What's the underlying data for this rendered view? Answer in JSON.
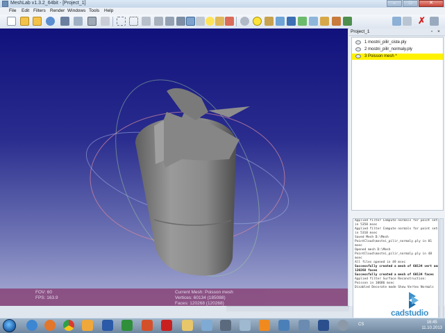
{
  "window": {
    "title": "MeshLab v1.3.2_64bit - [Project_1]"
  },
  "menu": [
    "File",
    "Edit",
    "Filters",
    "Render",
    "Windows",
    "Tools",
    "Help"
  ],
  "toolbar": {
    "icons": [
      "new-project-icon",
      "open-project-icon",
      "open-mesh-icon",
      "reload-icon",
      "save-icon",
      "snapshot-icon",
      "import-raster-icon",
      "print-icon",
      "bbox-icon",
      "points-icon",
      "wireframe-icon",
      "hidden-lines-icon",
      "flat-lines-icon",
      "flat-icon",
      "smooth-icon",
      "texture-icon",
      "light-icon",
      "double-light-icon",
      "fancy-light-icon",
      "backface-icon",
      "measure-icon",
      "annotation-icon",
      "edit-icon",
      "select-faces-icon",
      "select-vertices-icon",
      "move-icon",
      "paint-icon",
      "delete-icon",
      "filter-icon",
      "show-layer-icon"
    ]
  },
  "viewport": {
    "fov_label": "FOV: 60",
    "fps_label": "FPS:   163.9",
    "current_mesh": "Current Mesh: Poisson mesh",
    "vertices": "Vertices: 60134 (185088)",
    "faces": "Faces: 120268 (120268)"
  },
  "panel": {
    "title": "Project_1",
    "layers": [
      {
        "label": "1  mostni_pilir_ciste.ply",
        "selected": false
      },
      {
        "label": "2  mostni_pilir_normaly.ply",
        "selected": false
      },
      {
        "label": "3  Poisson mesh *",
        "selected": true
      }
    ],
    "log": [
      {
        "text": "Applied filter Compute normals for point sets",
        "bold": false
      },
      {
        "text": "in 5358 msec",
        "bold": false
      },
      {
        "text": "Applied filter Compute normals for point sets",
        "bold": false
      },
      {
        "text": "in 5310 msec",
        "bold": false
      },
      {
        "text": "Saved Mesh D:\\Mesh",
        "bold": false
      },
      {
        "text": "PointCloud\\mostni_pilir_normaly.ply in 81",
        "bold": false
      },
      {
        "text": "msec",
        "bold": false
      },
      {
        "text": "Opened mesh D:\\Mesh",
        "bold": false
      },
      {
        "text": "PointCloud\\mostni_pilir_normaly.ply in 48",
        "bold": false
      },
      {
        "text": "msec",
        "bold": false
      },
      {
        "text": "All files opened in 49 msec",
        "bold": false
      },
      {
        "text": "Successfully created a mesh of 60134 vert and",
        "bold": true
      },
      {
        "text": "120268 faces",
        "bold": true
      },
      {
        "text": "Successfully created a mesh of 60134 faces",
        "bold": true
      },
      {
        "text": "Applied filter Surface Reconstruction:",
        "bold": false
      },
      {
        "text": "Poisson in 10686 msec",
        "bold": false
      },
      {
        "text": "Disabled Decorate mode Show Vertex Normals",
        "bold": false
      }
    ]
  },
  "watermark": {
    "brand": "cadstudio"
  },
  "taskbar": {
    "apps": [
      "ie-icon",
      "firefox-icon",
      "chrome-icon",
      "outlook-icon",
      "word-icon",
      "excel-icon",
      "powerpoint-icon",
      "acrobat-icon",
      "explorer-icon",
      "network-icon",
      "meshlab-icon",
      "media-icon",
      "vlc-icon",
      "app-icon",
      "app-icon-2",
      "app-icon-3",
      "app-icon-4"
    ],
    "lang": "CS",
    "time": "16:45",
    "date": "11.10.2013"
  },
  "colors": {
    "selection": "#fff200",
    "viewport_top": "#11117c",
    "infobar": "#8a4b7e"
  }
}
